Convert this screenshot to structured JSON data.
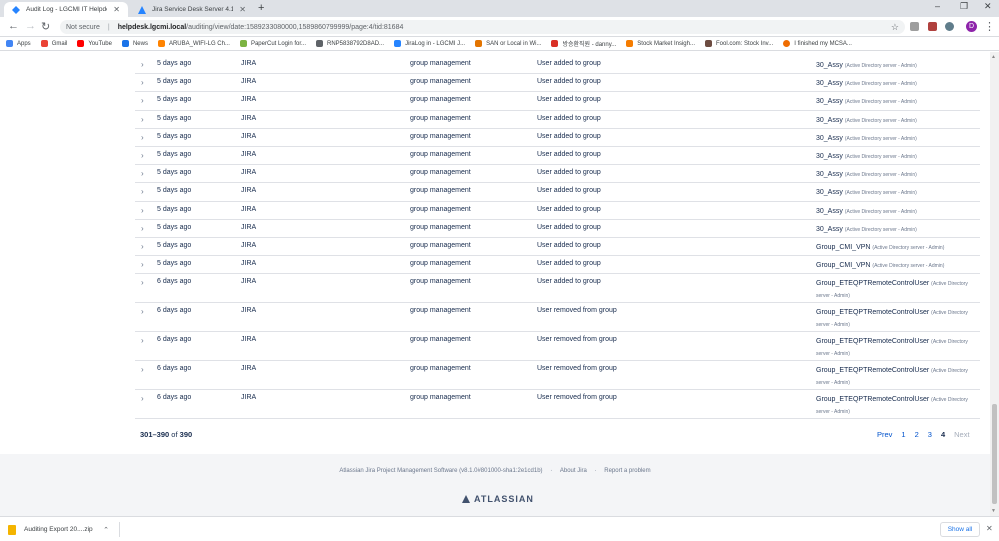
{
  "browser": {
    "tabs": [
      {
        "title": "Audit Log - LGCMI IT Helpdesk",
        "active": true
      },
      {
        "title": "Jira Service Desk Server 4.1 docu...",
        "active": false
      }
    ],
    "url_security": "Not secure",
    "url_host": "helpdesk.lgcmi.local",
    "url_path": "/auditing/view/date:1589233080000,1589860799999/page:4/tid:81684",
    "profile_initial": "D",
    "bookmarks": [
      "Apps",
      "Gmail",
      "YouTube",
      "News",
      "ARUBA_WIFI-LG Ch...",
      "PaperCut Login for...",
      "RNP5838792D8AD...",
      "JiraLog in - LGCMI J...",
      "SAN or Local in Wi...",
      "방승환직원 - danny...",
      "Stock Market Insigh...",
      "Fool.com: Stock Inv...",
      "I finished my MCSA..."
    ]
  },
  "audit": {
    "rows": [
      {
        "chev": "›",
        "date": "5 days ago",
        "source": "JIRA",
        "category": "group management",
        "summary": "User added to group",
        "object": "30_Assy",
        "object_sub": "(Active Directory server - Admin)"
      },
      {
        "chev": "›",
        "date": "5 days ago",
        "source": "JIRA",
        "category": "group management",
        "summary": "User added to group",
        "object": "30_Assy",
        "object_sub": "(Active Directory server - Admin)"
      },
      {
        "chev": "›",
        "date": "5 days ago",
        "source": "JIRA",
        "category": "group management",
        "summary": "User added to group",
        "object": "30_Assy",
        "object_sub": "(Active Directory server - Admin)"
      },
      {
        "chev": "›",
        "date": "5 days ago",
        "source": "JIRA",
        "category": "group management",
        "summary": "User added to group",
        "object": "30_Assy",
        "object_sub": "(Active Directory server - Admin)"
      },
      {
        "chev": "›",
        "date": "5 days ago",
        "source": "JIRA",
        "category": "group management",
        "summary": "User added to group",
        "object": "30_Assy",
        "object_sub": "(Active Directory server - Admin)"
      },
      {
        "chev": "›",
        "date": "5 days ago",
        "source": "JIRA",
        "category": "group management",
        "summary": "User added to group",
        "object": "30_Assy",
        "object_sub": "(Active Directory server - Admin)"
      },
      {
        "chev": "›",
        "date": "5 days ago",
        "source": "JIRA",
        "category": "group management",
        "summary": "User added to group",
        "object": "30_Assy",
        "object_sub": "(Active Directory server - Admin)"
      },
      {
        "chev": "›",
        "date": "5 days ago",
        "source": "JIRA",
        "category": "group management",
        "summary": "User added to group",
        "object": "30_Assy",
        "object_sub": "(Active Directory server - Admin)"
      },
      {
        "chev": "›",
        "date": "5 days ago",
        "source": "JIRA",
        "category": "group management",
        "summary": "User added to group",
        "object": "30_Assy",
        "object_sub": "(Active Directory server - Admin)"
      },
      {
        "chev": "›",
        "date": "5 days ago",
        "source": "JIRA",
        "category": "group management",
        "summary": "User added to group",
        "object": "30_Assy",
        "object_sub": "(Active Directory server - Admin)"
      },
      {
        "chev": "›",
        "date": "5 days ago",
        "source": "JIRA",
        "category": "group management",
        "summary": "User added to group",
        "object": "Group_CMI_VPN",
        "object_sub": "(Active Directory server - Admin)"
      },
      {
        "chev": "›",
        "date": "5 days ago",
        "source": "JIRA",
        "category": "group management",
        "summary": "User added to group",
        "object": "Group_CMI_VPN",
        "object_sub": "(Active Directory server - Admin)"
      },
      {
        "chev": "›",
        "date": "6 days ago",
        "source": "JIRA",
        "category": "group management",
        "summary": "User added to group",
        "object": "Group_ETEQPTRemoteControlUser",
        "object_sub": "(Active Directory server - Admin)"
      },
      {
        "chev": "›",
        "date": "6 days ago",
        "source": "JIRA",
        "category": "group management",
        "summary": "User removed from group",
        "object": "Group_ETEQPTRemoteControlUser",
        "object_sub": "(Active Directory server - Admin)"
      },
      {
        "chev": "›",
        "date": "6 days ago",
        "source": "JIRA",
        "category": "group management",
        "summary": "User removed from group",
        "object": "Group_ETEQPTRemoteControlUser",
        "object_sub": "(Active Directory server - Admin)"
      },
      {
        "chev": "›",
        "date": "6 days ago",
        "source": "JIRA",
        "category": "group management",
        "summary": "User removed from group",
        "object": "Group_ETEQPTRemoteControlUser",
        "object_sub": "(Active Directory server - Admin)"
      },
      {
        "chev": "›",
        "date": "6 days ago",
        "source": "JIRA",
        "category": "group management",
        "summary": "User removed from group",
        "object": "Group_ETEQPTRemoteControlUser",
        "object_sub": "(Active Directory server - Admin)"
      }
    ],
    "pager_range": "301–390",
    "pager_of": "of",
    "pager_total": "390",
    "pages": {
      "prev": "Prev",
      "p1": "1",
      "p2": "2",
      "p3": "3",
      "p4": "4",
      "next": "Next"
    }
  },
  "footer": {
    "software": "Atlassian Jira Project Management Software (v8.1.0#801000-sha1:2e1cd1b)",
    "dot1": "·",
    "about": "About Jira",
    "dot2": "·",
    "report": "Report a problem",
    "logo": "ATLASSIAN"
  },
  "downloads": {
    "file": "Auditing Export 20....zip",
    "show_all": "Show all"
  }
}
